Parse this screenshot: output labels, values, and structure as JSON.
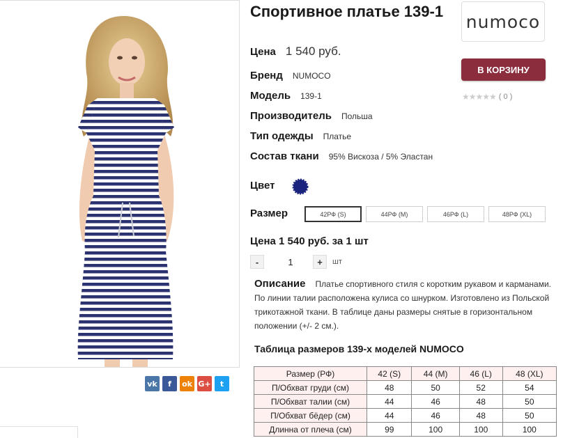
{
  "product": {
    "title": "Спортивное платье 139-1",
    "price_label": "Цена",
    "price_value": "1 540 руб.",
    "brand_label": "Бренд",
    "brand_value": "NUMOCO",
    "model_label": "Модель",
    "model_value": "139-1",
    "maker_label": "Производитель",
    "maker_value": "Польша",
    "type_label": "Тип одежды",
    "type_value": "Платье",
    "fabric_label": "Состав ткани",
    "fabric_value": "95% Вискоза / 5% Эластан",
    "color_label": "Цвет",
    "color_hex": "#1a237e",
    "size_label": "Размер",
    "total_text": "Цена 1 540 руб. за 1 шт"
  },
  "brand_logo": {
    "text": "numoco"
  },
  "cart_button": {
    "label": "В КОРЗИНУ",
    "color": "#8b2d3d"
  },
  "rating": {
    "stars": "★★★★★",
    "count": "( 0 )"
  },
  "sizes": [
    {
      "label": "42РФ (S)",
      "selected": true
    },
    {
      "label": "44РФ (M)",
      "selected": false
    },
    {
      "label": "46РФ (L)",
      "selected": false
    },
    {
      "label": "48РФ (XL)",
      "selected": false
    }
  ],
  "quantity": {
    "minus": "-",
    "value": "1",
    "plus": "+",
    "unit": "шт"
  },
  "description": {
    "label": "Описание",
    "text": "Платье спортивного стиля с коротким рукавом и карманами. По линии талии расположена кулиса со шнурком. Изготовлено из Польской трикотажной ткани. В таблице даны размеры снятые в горизонтальном положении (+/- 2 см.)."
  },
  "size_table": {
    "title": "Таблица размеров 139-х моделей NUMOCO",
    "headers": [
      "Размер (РФ)",
      "42 (S)",
      "44 (M)",
      "46 (L)",
      "48 (XL)"
    ],
    "rows": [
      [
        "П/Обхват груди (см)",
        "48",
        "50",
        "52",
        "54"
      ],
      [
        "П/Обхват талии (см)",
        "44",
        "46",
        "48",
        "50"
      ],
      [
        "П/Обхват бёдер (см)",
        "44",
        "46",
        "48",
        "50"
      ],
      [
        "Длинна от плеча (см)",
        "99",
        "100",
        "100",
        "100"
      ]
    ]
  },
  "share": [
    {
      "icon": "vk-icon",
      "glyph": "vk",
      "color": "#4a76a8"
    },
    {
      "icon": "facebook-icon",
      "glyph": "f",
      "color": "#3b5998"
    },
    {
      "icon": "odnoklassniki-icon",
      "glyph": "ok",
      "color": "#ee8208"
    },
    {
      "icon": "google-plus-icon",
      "glyph": "G+",
      "color": "#dc4e41"
    },
    {
      "icon": "twitter-icon",
      "glyph": "t",
      "color": "#1da1f2"
    }
  ]
}
